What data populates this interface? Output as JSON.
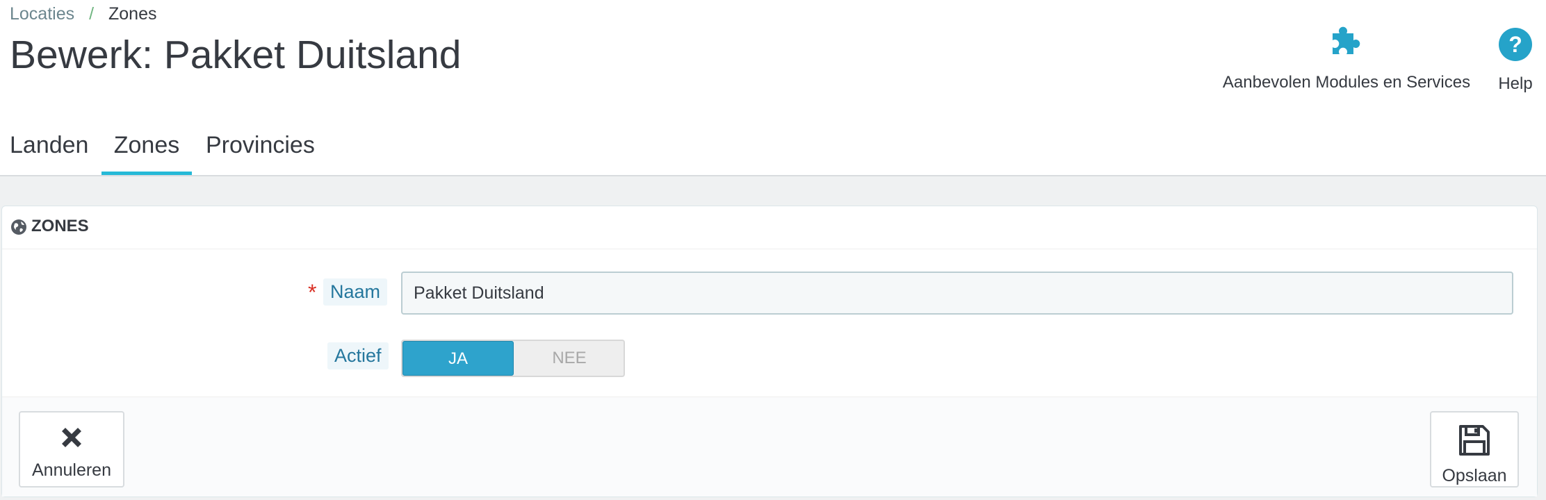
{
  "breadcrumb": {
    "items": [
      "Locaties",
      "Zones"
    ],
    "separator": "/"
  },
  "page": {
    "title": "Bewerk: Pakket Duitsland"
  },
  "toolbar": {
    "modules_label": "Aanbevolen Modules en Services",
    "modules_icon": "puzzle-icon",
    "help_label": "Help",
    "help_icon": "question-circle-icon"
  },
  "tabs": [
    {
      "label": "Landen",
      "active": false
    },
    {
      "label": "Zones",
      "active": true
    },
    {
      "label": "Provincies",
      "active": false
    }
  ],
  "panel": {
    "title": "ZONES",
    "icon": "globe-icon",
    "fields": {
      "naam": {
        "label": "Naam",
        "required_mark": "*",
        "value": "Pakket Duitsland"
      },
      "actief": {
        "label": "Actief",
        "yes_label": "JA",
        "no_label": "NEE",
        "selected": "JA"
      }
    },
    "footer": {
      "cancel_label": "Annuleren",
      "cancel_icon": "close-icon",
      "save_label": "Opslaan",
      "save_icon": "floppy-disk-icon"
    }
  },
  "colors": {
    "accent": "#25b9d7",
    "switch_active": "#2ea3cc",
    "label_text": "#25779d",
    "required": "#d93025",
    "breadcrumb_sep": "#70b580"
  }
}
